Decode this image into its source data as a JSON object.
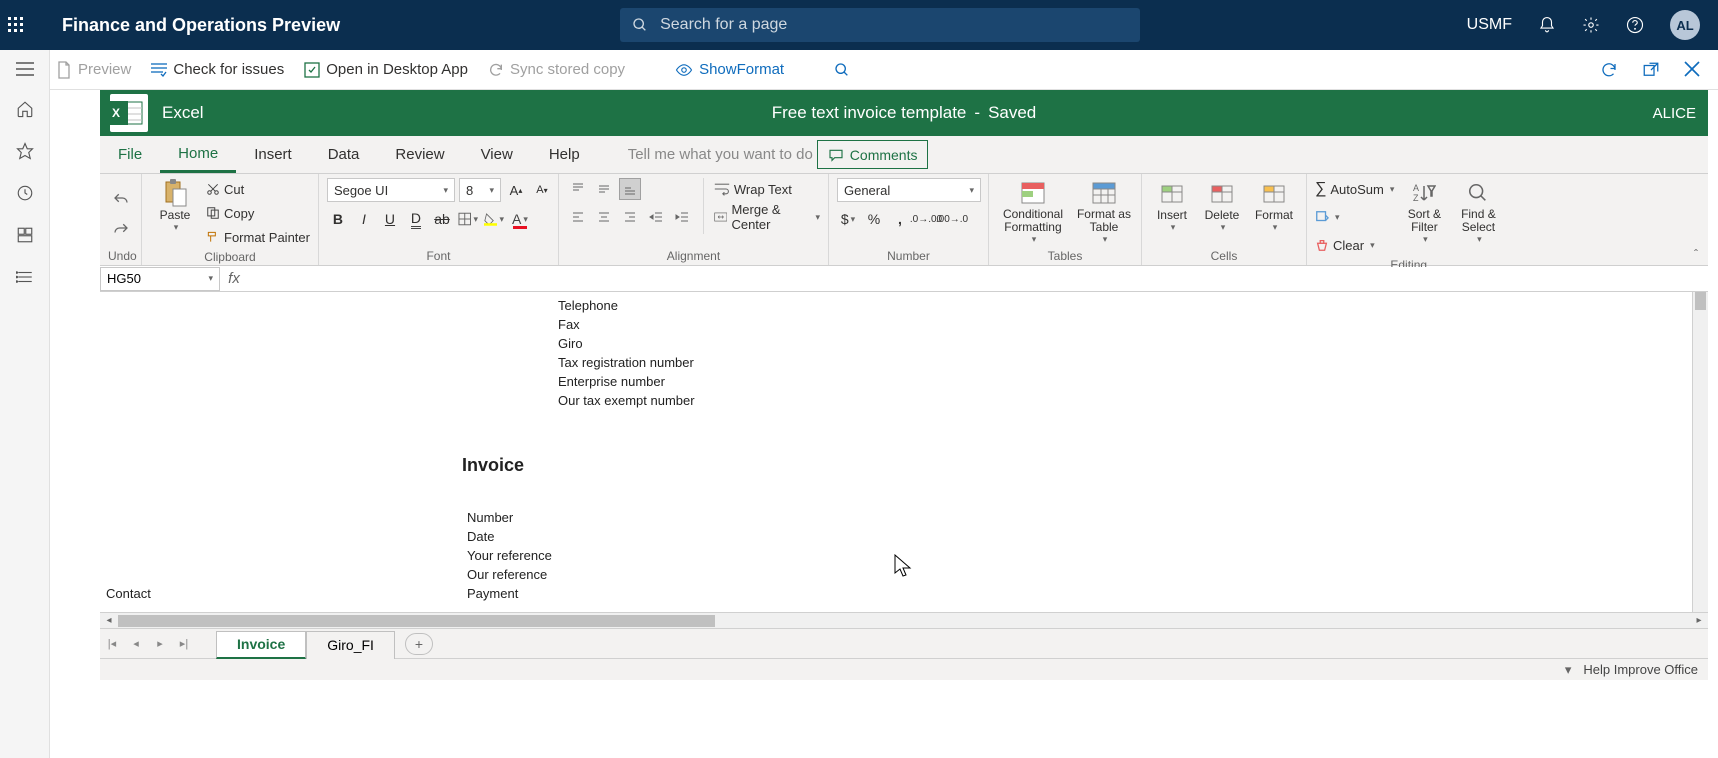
{
  "header": {
    "title": "Finance and Operations Preview",
    "search_placeholder": "Search for a page",
    "company": "USMF",
    "avatar": "AL"
  },
  "subtoolbar": {
    "preview": "Preview",
    "check": "Check for issues",
    "open_desktop": "Open in Desktop App",
    "sync": "Sync stored copy",
    "showformat": "ShowFormat"
  },
  "excel": {
    "app_name": "Excel",
    "doc_name": "Free text invoice template",
    "dash": "-",
    "saved": "Saved",
    "user": "ALICE",
    "tabs": {
      "file": "File",
      "home": "Home",
      "insert": "Insert",
      "data": "Data",
      "review": "Review",
      "view": "View",
      "help": "Help",
      "tellme": "Tell me what you want to do",
      "comments": "Comments"
    },
    "ribbon": {
      "undo": "Undo",
      "paste": "Paste",
      "cut": "Cut",
      "copy": "Copy",
      "format_painter": "Format Painter",
      "clipboard": "Clipboard",
      "font_name": "Segoe UI",
      "font_size": "8",
      "font": "Font",
      "wrap": "Wrap Text",
      "merge": "Merge & Center",
      "alignment": "Alignment",
      "number_format": "General",
      "number": "Number",
      "cond_fmt": "Conditional Formatting",
      "fmt_table": "Format as Table",
      "tables": "Tables",
      "insert_btn": "Insert",
      "delete_btn": "Delete",
      "format_btn": "Format",
      "cells": "Cells",
      "autosum": "AutoSum",
      "clear": "Clear",
      "sort_filter": "Sort & Filter",
      "find_select": "Find & Select",
      "editing": "Editing"
    },
    "namebox": "HG50",
    "sheet_content": {
      "telephone": "Telephone",
      "fax": "Fax",
      "giro": "Giro",
      "tax_reg": "Tax registration number",
      "enterprise": "Enterprise number",
      "tax_exempt": "Our tax exempt number",
      "invoice_title": "Invoice",
      "number": "Number",
      "date": "Date",
      "your_ref": "Your reference",
      "our_ref": "Our reference",
      "payment": "Payment",
      "contact": "Contact"
    },
    "sheet_tabs": {
      "invoice": "Invoice",
      "giro": "Giro_FI"
    },
    "status": {
      "help": "Help Improve Office"
    }
  }
}
